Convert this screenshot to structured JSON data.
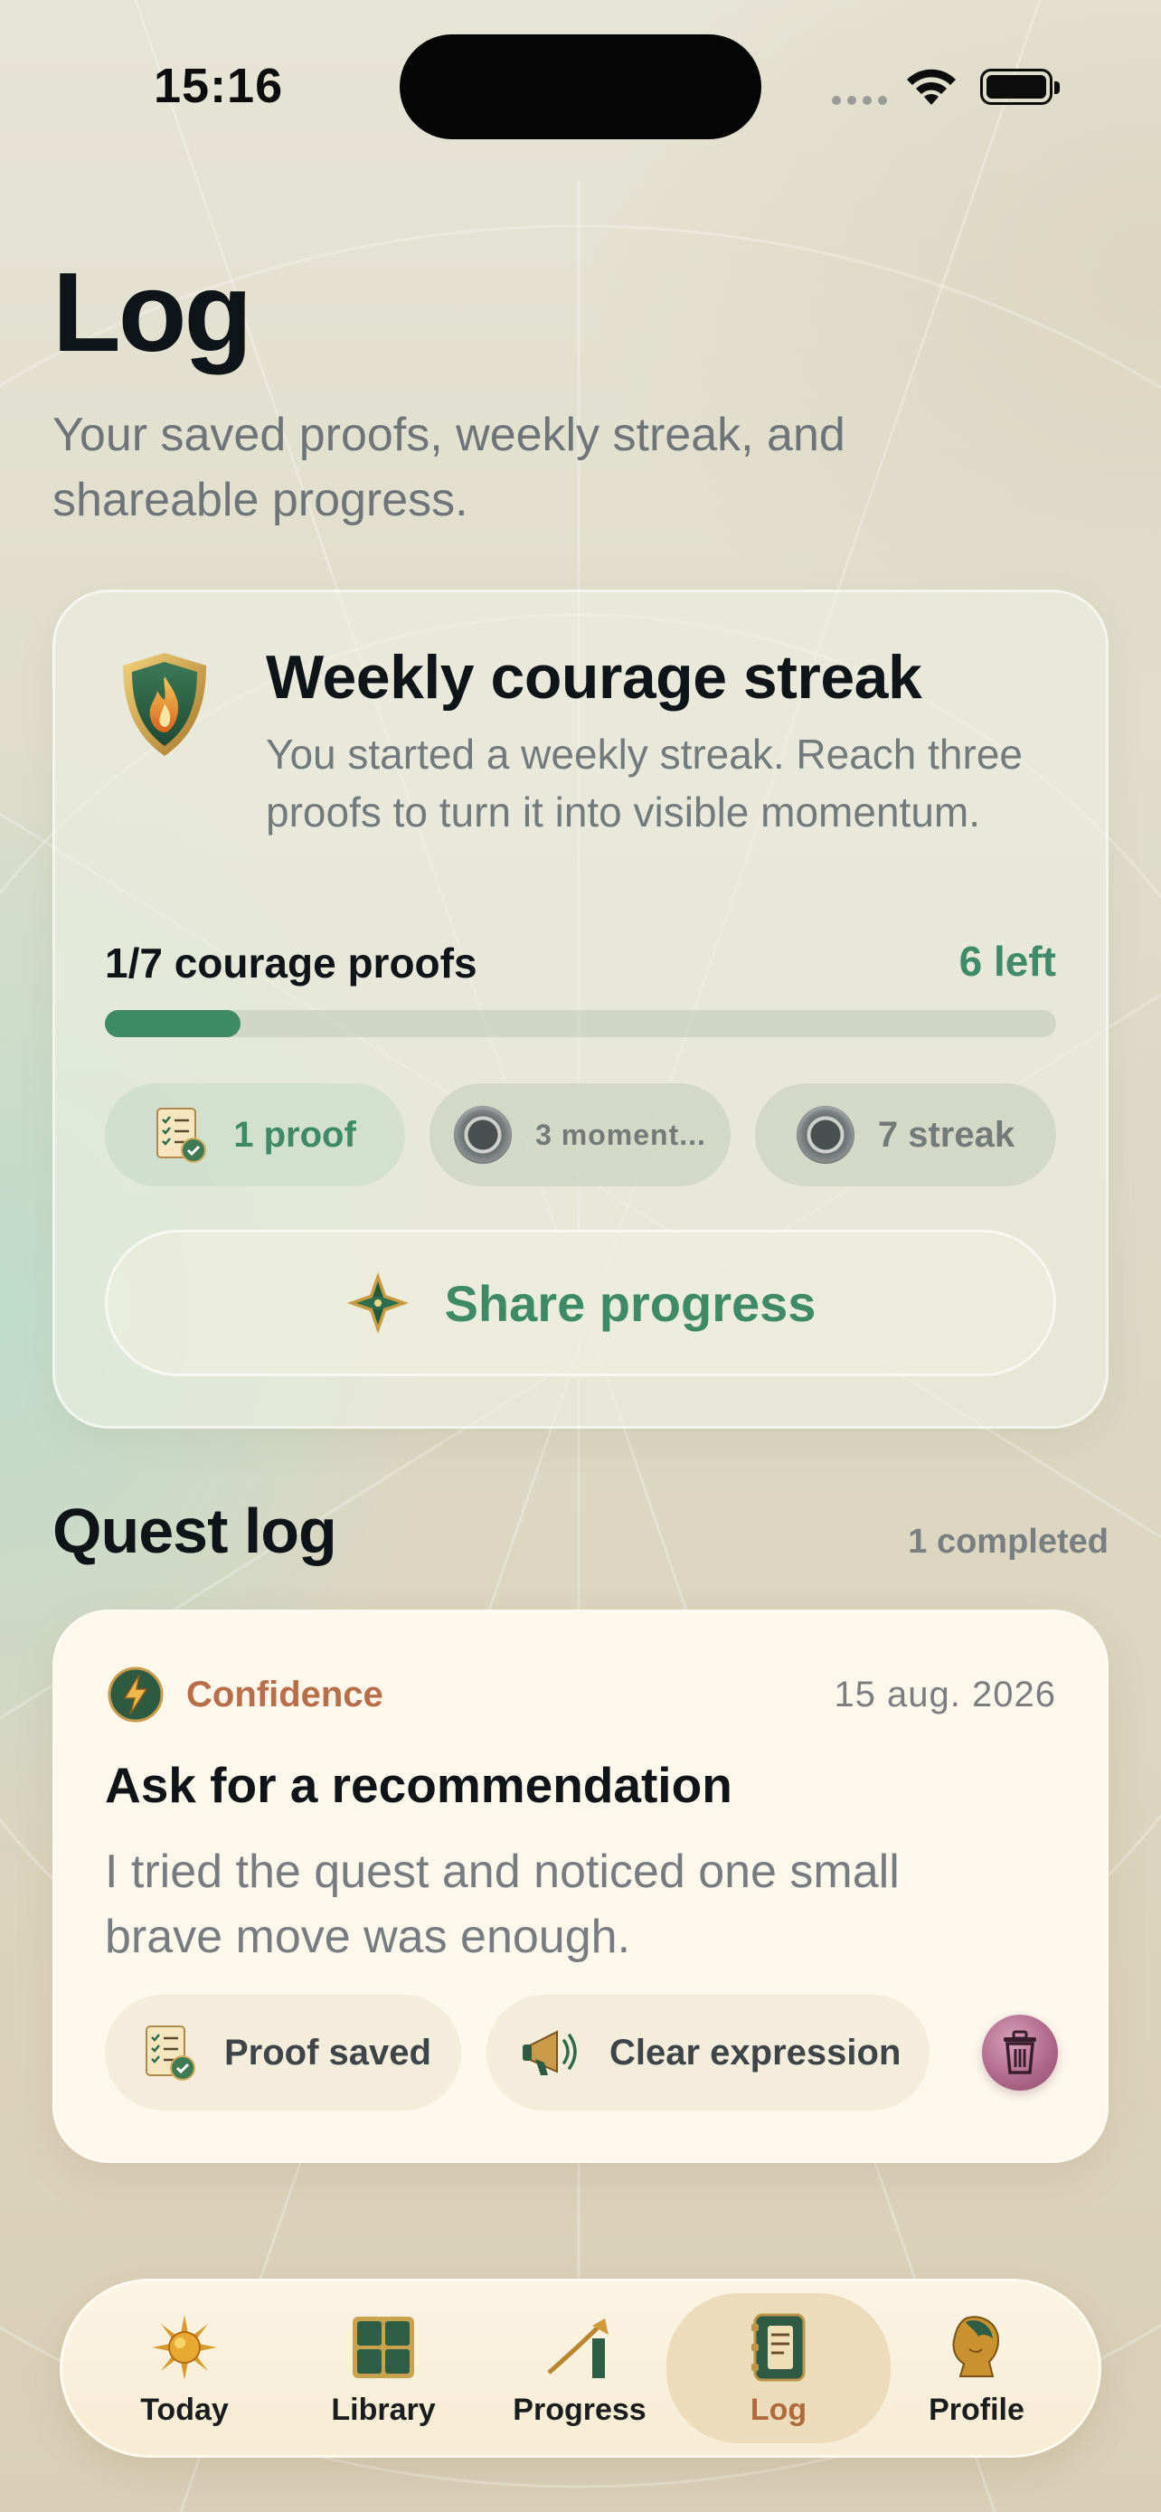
{
  "status_bar": {
    "time": "15:16"
  },
  "header": {
    "title": "Log",
    "subtitle": "Your saved proofs, weekly streak, and shareable progress."
  },
  "streak_card": {
    "title": "Weekly courage streak",
    "description": "You started a weekly streak. Reach three proofs to turn it into visible momentum.",
    "progress_label": "1/7 courage proofs",
    "remaining_label": "6 left",
    "progress_fraction": 0.143,
    "chips": [
      {
        "label": "1 proof",
        "state": "achieved",
        "icon": "checklist-icon"
      },
      {
        "label": "3 moment...",
        "state": "locked",
        "icon": "ring-icon"
      },
      {
        "label": "7 streak",
        "state": "locked",
        "icon": "ring-icon"
      }
    ],
    "share_label": "Share progress"
  },
  "quest_log": {
    "title": "Quest log",
    "count_label": "1 completed",
    "entries": [
      {
        "category": "Confidence",
        "date": "15 aug. 2026",
        "title": "Ask for a recommendation",
        "note": "I tried the quest and noticed one small brave move was enough.",
        "tags": [
          "Proof saved",
          "Clear expression"
        ]
      }
    ]
  },
  "tab_bar": {
    "items": [
      {
        "label": "Today",
        "icon": "sun-icon"
      },
      {
        "label": "Library",
        "icon": "grid-icon"
      },
      {
        "label": "Progress",
        "icon": "rising-arrow-icon"
      },
      {
        "label": "Log",
        "icon": "journal-icon"
      },
      {
        "label": "Profile",
        "icon": "bust-icon"
      }
    ],
    "active": "Log"
  },
  "colors": {
    "accent_green": "#3f8a66",
    "accent_copper": "#b86e4a",
    "active_tab_label": "#b06a3e"
  }
}
